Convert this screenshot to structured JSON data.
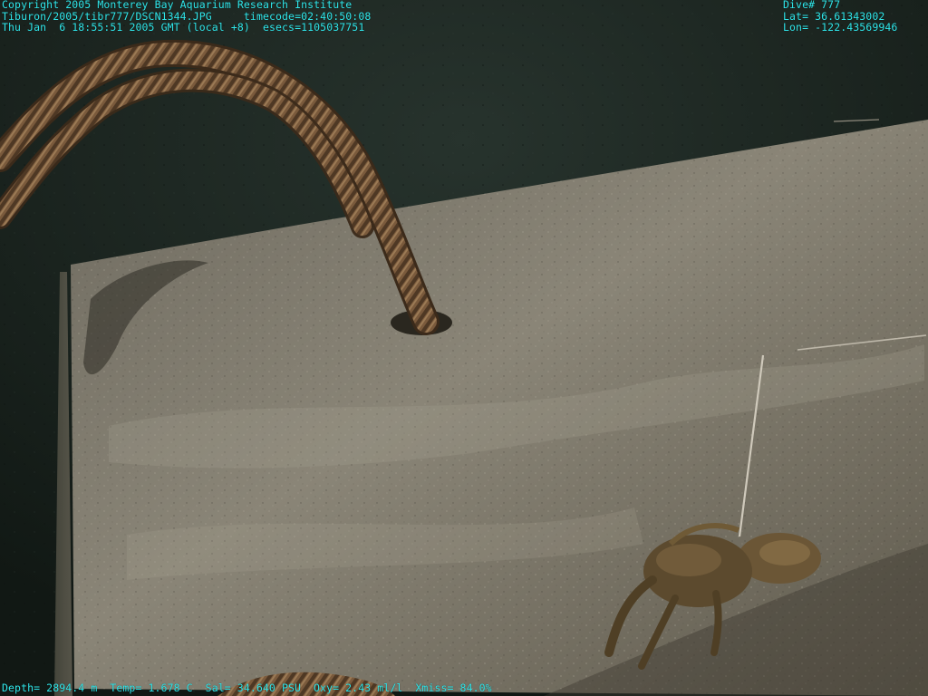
{
  "overlay": {
    "top_left": [
      "Copyright 2005 Monterey Bay Aquarium Research Institute",
      "Tiburon/2005/tibr777/DSCN1344.JPG     timecode=02:40:50:08",
      "Thu Jan  6 18:55:51 2005 GMT (local +8)  esecs=1105037751"
    ],
    "top_right": [
      "Dive# 777",
      "Lat= 36.61343002",
      "Lon= -122.43569946"
    ],
    "bottom": {
      "depth": "Depth= 2894.4 m",
      "temp": "Temp= 1.678 C",
      "sal": "Sal= 34.640 PSU",
      "oxy": "Oxy= 2.43 ml/l",
      "xmiss": "Xmiss= 84.0%"
    },
    "color": "#2fe6ea"
  },
  "scene": {
    "subject": "concrete-block-with-rope-on-seafloor",
    "colors": {
      "seafloor": "#1e2a24",
      "block_top": "#7c776a",
      "rope": "#7a5a3c",
      "creature": "#6e5a3a"
    }
  }
}
